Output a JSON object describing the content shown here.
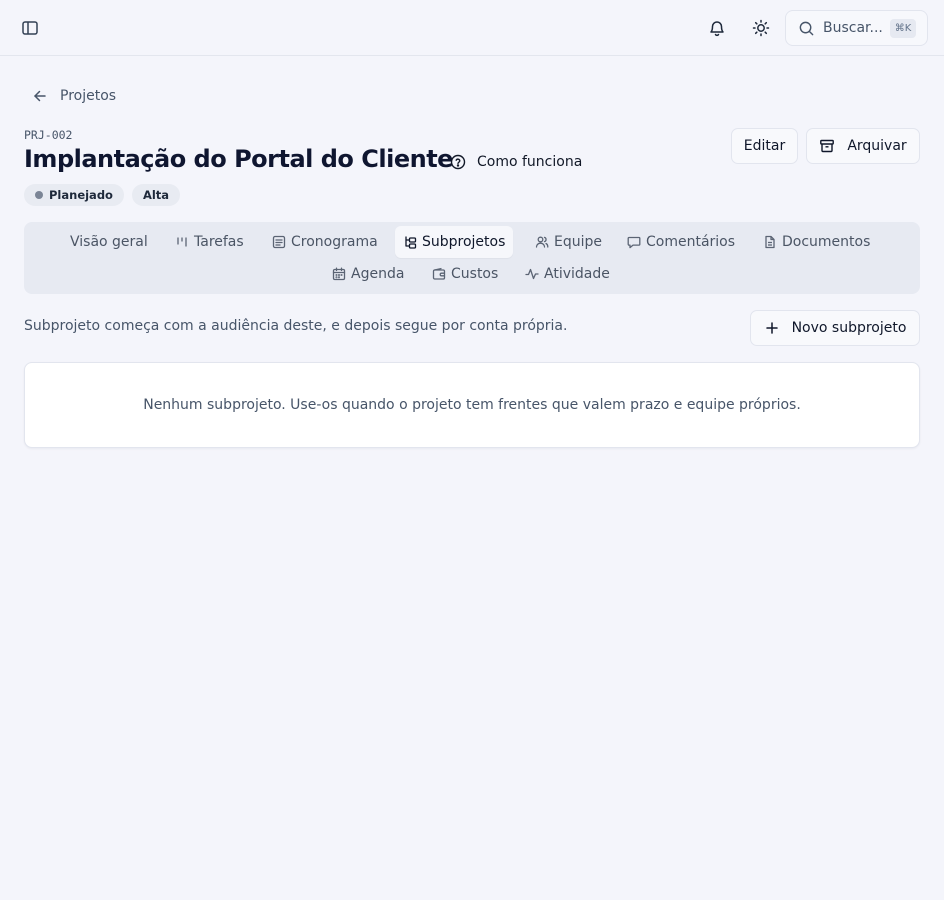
{
  "topbar": {
    "search_placeholder": "Buscar...",
    "search_shortcut": "⌘K",
    "icons": [
      "sidebar-toggle-icon",
      "bell-icon",
      "sun-icon",
      "search-icon"
    ]
  },
  "breadcrumb": {
    "back_label": "Projetos"
  },
  "project": {
    "code": "PRJ-002",
    "title": "Implantação do Portal do Cliente",
    "how_it_works": "Como funciona",
    "status_badge": "Planejado",
    "priority_badge": "Alta"
  },
  "actions": {
    "edit": "Editar",
    "archive": "Arquivar"
  },
  "tabs": [
    {
      "label": "Visão geral",
      "icon": "none"
    },
    {
      "label": "Tarefas",
      "icon": "kanban-icon"
    },
    {
      "label": "Cronograma",
      "icon": "list-icon"
    },
    {
      "label": "Subprojetos",
      "icon": "subproject-icon",
      "active": true
    },
    {
      "label": "Equipe",
      "icon": "users-icon"
    },
    {
      "label": "Comentários",
      "icon": "comment-icon"
    },
    {
      "label": "Documentos",
      "icon": "document-icon"
    },
    {
      "label": "Agenda",
      "icon": "calendar-icon"
    },
    {
      "label": "Custos",
      "icon": "wallet-icon"
    },
    {
      "label": "Atividade",
      "icon": "activity-icon"
    }
  ],
  "subprojects": {
    "description": "Subprojeto começa com a audiência deste, e depois segue por conta própria.",
    "new_button": "Novo subprojeto",
    "empty_message": "Nenhum subprojeto. Use-os quando o projeto tem frentes que valem prazo e equipe próprios."
  },
  "colors": {
    "background": "#f4f5fb",
    "tabs_background": "#e7eaf2",
    "title": "#0f1630",
    "status_dot": "#7b8596"
  }
}
